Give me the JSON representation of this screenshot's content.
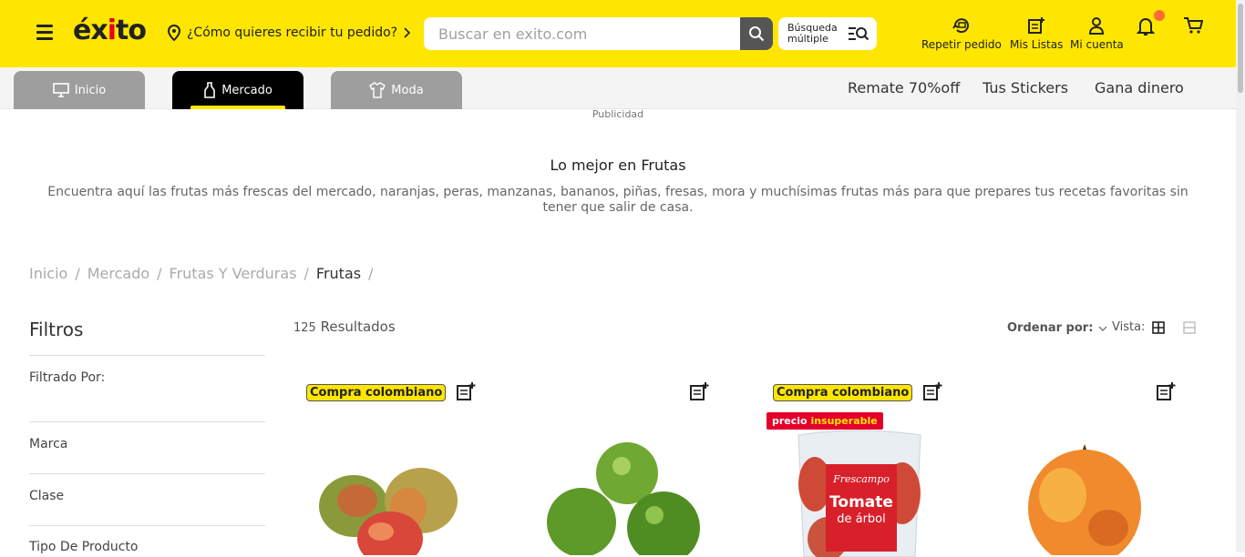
{
  "header": {
    "logo": "éxito",
    "delivery_prompt": "¿Cómo quieres recibir tu pedido?",
    "search_placeholder": "Buscar en exito.com",
    "multi_search_line1": "Búsqueda",
    "multi_search_line2": "múltiple",
    "repeat_order": "Repetir pedido",
    "my_lists": "Mis Listas",
    "my_account": "Mi cuenta"
  },
  "nav": {
    "tabs": [
      {
        "label": "Inicio",
        "icon": "monitor-icon"
      },
      {
        "label": "Mercado",
        "icon": "bottle-icon"
      },
      {
        "label": "Moda",
        "icon": "shirt-icon"
      }
    ],
    "links": [
      "Remate 70%off",
      "Tus Stickers",
      "Gana dinero"
    ]
  },
  "ad_label": "Publicidad",
  "category": {
    "title": "Lo mejor en Frutas",
    "description": "Encuentra aquí las frutas más frescas del mercado, naranjas, peras, manzanas, bananos, piñas, fresas, mora y muchísimas frutas más para que prepares tus recetas favoritas sin tener que salir de casa."
  },
  "breadcrumb": [
    "Inicio",
    "Mercado",
    "Frutas Y Verduras",
    "Frutas"
  ],
  "filters": {
    "title": "Filtros",
    "filtered_by": "Filtrado Por:",
    "groups": [
      "Marca",
      "Clase",
      "Tipo De Producto"
    ]
  },
  "results": {
    "count": "125",
    "label": "Resultados"
  },
  "sort_label": "Ordenar por:",
  "view_label": "Vista:",
  "products": [
    {
      "badge": "Compra colombiano",
      "promo_a": "",
      "promo_b": ""
    },
    {
      "badge": "",
      "promo_a": "",
      "promo_b": ""
    },
    {
      "badge": "Compra colombiano",
      "promo_a": "precio",
      "promo_b": "insuperable",
      "package_brand": "Frescampo",
      "package_title_1": "Tomate",
      "package_title_2": "de árbol"
    },
    {
      "badge": "",
      "promo_a": "",
      "promo_b": ""
    }
  ],
  "colors": {
    "brand_yellow": "#ffe600",
    "brand_red": "#e4002b",
    "notification": "#ff6b35"
  }
}
